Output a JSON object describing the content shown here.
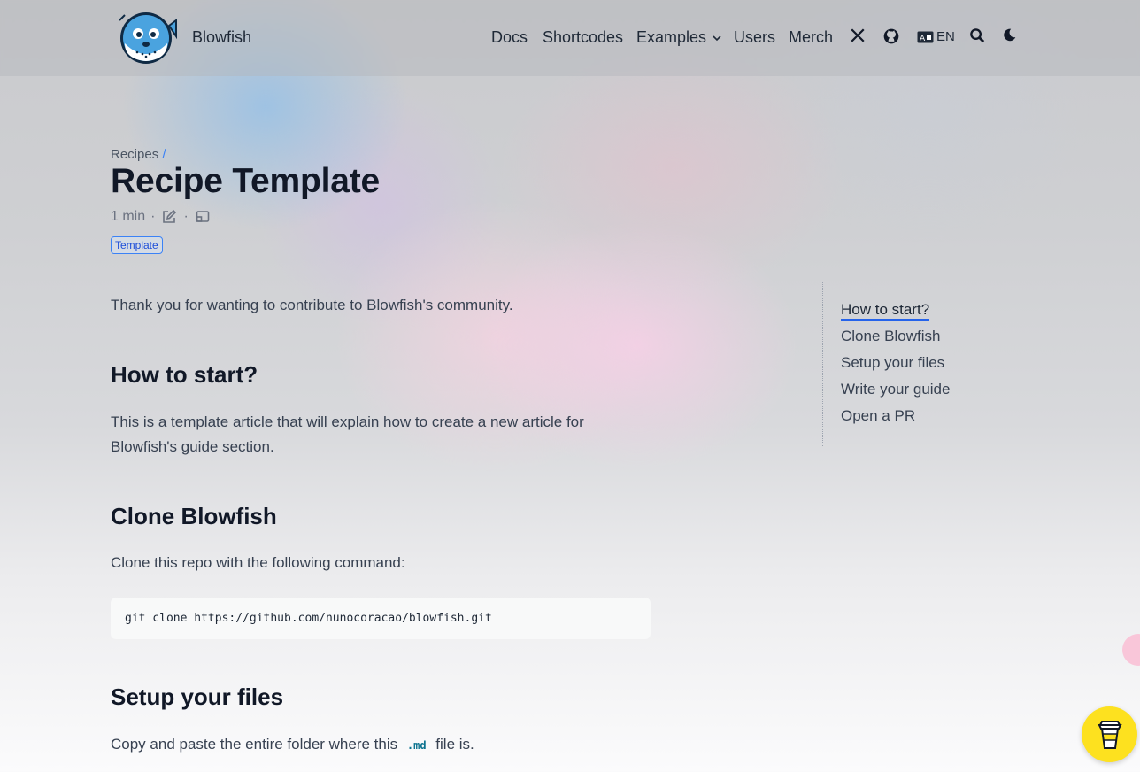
{
  "header": {
    "brand": "Blowfish",
    "nav": {
      "docs": "Docs",
      "shortcodes": "Shortcodes",
      "examples": "Examples",
      "users": "Users",
      "merch": "Merch",
      "lang": "EN"
    },
    "icons": [
      "x-icon",
      "github-icon",
      "translate-icon",
      "search-icon",
      "moon-icon",
      "chevron-down-icon"
    ]
  },
  "article": {
    "breadcrumb": "Recipes",
    "breadcrumb_sep": "/",
    "title": "Recipe Template",
    "reading_time": "1 min",
    "meta_sep": "·",
    "tag": "Template",
    "intro": "Thank you for wanting to contribute to Blowfish's community.",
    "sections": {
      "start_heading": "How to start?",
      "start_text": "This is a template article that will explain how to create a new article for Blowfish's guide section.",
      "clone_heading": "Clone Blowfish",
      "clone_text": "Clone this repo with the following command:",
      "clone_code": "git clone https://github.com/nunocoracao/blowfish.git",
      "setup_heading": "Setup your files",
      "setup_text_before": "Copy and paste the entire folder where this",
      "setup_code": ".md",
      "setup_text_after": "file is."
    }
  },
  "toc": {
    "items": [
      "How to start?",
      "Clone Blowfish",
      "Setup your files",
      "Write your guide",
      "Open a PR"
    ],
    "active_index": 0
  },
  "colors": {
    "accent": "#2563eb",
    "coffee_button": "#fde11f",
    "tag_border": "#3b82f6"
  }
}
